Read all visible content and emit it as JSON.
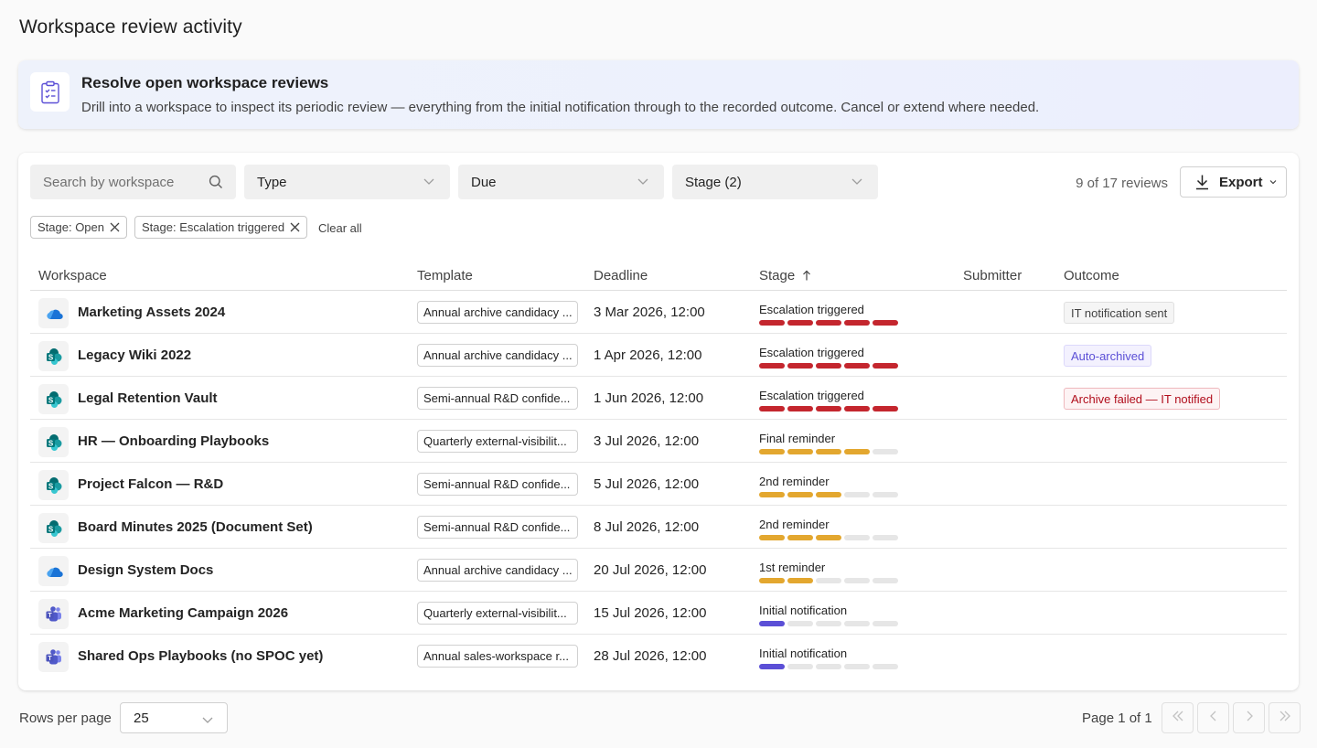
{
  "page": {
    "title": "Workspace review activity"
  },
  "banner": {
    "icon": "clipboard-checklist-icon",
    "title": "Resolve open workspace reviews",
    "description": "Drill into a workspace to inspect its periodic review — everything from the initial notification through to the recorded outcome. Cancel or extend where needed."
  },
  "toolbar": {
    "search_placeholder": "Search by workspace",
    "type_label": "Type",
    "due_label": "Due",
    "stage_label": "Stage (2)",
    "count_text": "9 of 17 reviews",
    "export_label": "Export"
  },
  "chips": [
    {
      "label": "Stage: Open"
    },
    {
      "label": "Stage: Escalation triggered"
    }
  ],
  "clear_all": "Clear all",
  "columns": {
    "workspace": "Workspace",
    "template": "Template",
    "deadline": "Deadline",
    "stage": "Stage",
    "submitter": "Submitter",
    "outcome": "Outcome"
  },
  "colors": {
    "escalation": "#c4262e",
    "reminder": "#e3a72f",
    "initial": "#5b4fd6",
    "empty": "#e6e6e6"
  },
  "rows": [
    {
      "icon": "onedrive-icon",
      "workspace": "Marketing Assets 2024",
      "template": "Annual archive candidacy ...",
      "deadline": "3 Mar 2026, 12:00",
      "stage": "Escalation triggered",
      "stage_level": 5,
      "stage_kind": "escalation",
      "outcome": "IT notification sent",
      "outcome_style": "neutral"
    },
    {
      "icon": "sharepoint-icon",
      "workspace": "Legacy Wiki 2022",
      "template": "Annual archive candidacy ...",
      "deadline": "1 Apr 2026, 12:00",
      "stage": "Escalation triggered",
      "stage_level": 5,
      "stage_kind": "escalation",
      "outcome": "Auto-archived",
      "outcome_style": "purple"
    },
    {
      "icon": "sharepoint-icon",
      "workspace": "Legal Retention Vault",
      "template": "Semi-annual R&D confide...",
      "deadline": "1 Jun 2026, 12:00",
      "stage": "Escalation triggered",
      "stage_level": 5,
      "stage_kind": "escalation",
      "outcome": "Archive failed — IT notified",
      "outcome_style": "danger"
    },
    {
      "icon": "sharepoint-icon",
      "workspace": "HR — Onboarding Playbooks",
      "template": "Quarterly external-visibilit...",
      "deadline": "3 Jul 2026, 12:00",
      "stage": "Final reminder",
      "stage_level": 4,
      "stage_kind": "reminder",
      "outcome": "",
      "outcome_style": ""
    },
    {
      "icon": "sharepoint-icon",
      "workspace": "Project Falcon — R&D",
      "template": "Semi-annual R&D confide...",
      "deadline": "5 Jul 2026, 12:00",
      "stage": "2nd reminder",
      "stage_level": 3,
      "stage_kind": "reminder",
      "outcome": "",
      "outcome_style": ""
    },
    {
      "icon": "sharepoint-icon",
      "workspace": "Board Minutes 2025 (Document Set)",
      "template": "Semi-annual R&D confide...",
      "deadline": "8 Jul 2026, 12:00",
      "stage": "2nd reminder",
      "stage_level": 3,
      "stage_kind": "reminder",
      "outcome": "",
      "outcome_style": ""
    },
    {
      "icon": "onedrive-icon",
      "workspace": "Design System Docs",
      "template": "Annual archive candidacy ...",
      "deadline": "20 Jul 2026, 12:00",
      "stage": "1st reminder",
      "stage_level": 2,
      "stage_kind": "reminder",
      "outcome": "",
      "outcome_style": ""
    },
    {
      "icon": "teams-icon",
      "workspace": "Acme Marketing Campaign 2026",
      "template": "Quarterly external-visibilit...",
      "deadline": "15 Jul 2026, 12:00",
      "stage": "Initial notification",
      "stage_level": 1,
      "stage_kind": "initial",
      "outcome": "",
      "outcome_style": ""
    },
    {
      "icon": "teams-icon",
      "workspace": "Shared Ops Playbooks (no SPOC yet)",
      "template": "Annual sales-workspace r...",
      "deadline": "28 Jul 2026, 12:00",
      "stage": "Initial notification",
      "stage_level": 1,
      "stage_kind": "initial",
      "outcome": "",
      "outcome_style": ""
    }
  ],
  "footer": {
    "rows_per_page_label": "Rows per page",
    "rows_per_page_value": "25",
    "page_info": "Page 1 of 1"
  }
}
